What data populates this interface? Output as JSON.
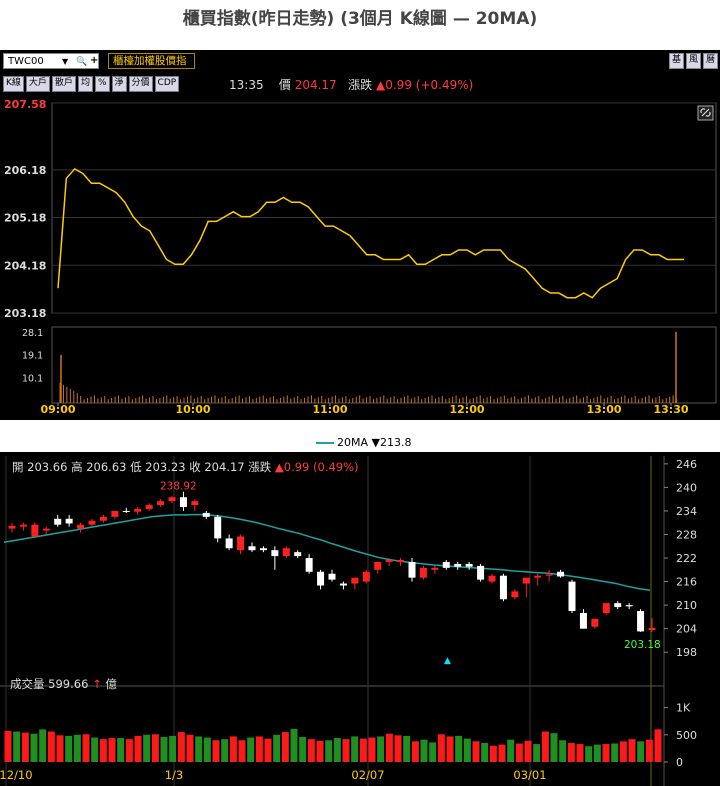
{
  "page_title": "櫃買指數(昨日走勢) (3個月 K線圖  — 20MA)",
  "toolbar": {
    "symbol": "TWC00",
    "symbol_dropdown_icon": "▼",
    "search_icon": "🔍",
    "add_icon": "+",
    "name_tab": "櫃檯加權股價指",
    "right_tabs": [
      "基",
      "風",
      "曆"
    ],
    "buttons": [
      "K線",
      "大戶",
      "散戶",
      "均",
      "%",
      "淨",
      "分價",
      "CDP"
    ],
    "time": "13:35",
    "price_label": "價",
    "price": "204.17",
    "change_label": "漲跌",
    "change": "▲0.99 (+0.49%)",
    "link_icon": "link-icon"
  },
  "intraday": {
    "y_ticks": [
      "207.58",
      "206.18",
      "205.18",
      "204.18",
      "203.18"
    ],
    "vol_ticks": [
      "28.1",
      "19.1",
      "10.1"
    ],
    "x_ticks": [
      "09:00",
      "10:00",
      "11:00",
      "12:00",
      "13:00",
      "13:30"
    ]
  },
  "kline": {
    "legend_label": "20MA",
    "legend_value": "▼213.8",
    "ohlc": {
      "open_label": "開",
      "open": "203.66",
      "high_label": "高",
      "high": "206.63",
      "low_label": "低",
      "low": "203.23",
      "close_label": "收",
      "close": "204.17",
      "change_label": "漲跌",
      "change": "▲0.99 (0.49%)"
    },
    "high_annotation": "238.92",
    "low_annotation": "203.18",
    "y_ticks": [
      "246",
      "240",
      "234",
      "228",
      "222",
      "216",
      "210",
      "204",
      "198"
    ],
    "vol_ticks": [
      "1K",
      "500",
      "0"
    ],
    "x_ticks": [
      "12/10",
      "1/3",
      "02/07",
      "03/01"
    ],
    "volume_label": "成交量",
    "volume_value": "599.66",
    "volume_arrow": "↑",
    "volume_unit": "億"
  },
  "chart_data": [
    {
      "type": "line",
      "title": "",
      "x_ticks": [
        "09:00",
        "10:00",
        "11:00",
        "12:00",
        "13:00",
        "13:30"
      ],
      "ylim": [
        203.18,
        207.58
      ],
      "series": [
        {
          "values": [
            203.7,
            206.0,
            206.2,
            206.1,
            205.9,
            205.9,
            205.8,
            205.7,
            205.5,
            205.2,
            205.0,
            204.9,
            204.6,
            204.3,
            204.2,
            204.2,
            204.4,
            204.7,
            205.1,
            205.1,
            205.2,
            205.3,
            205.2,
            205.2,
            205.3,
            205.5,
            205.5,
            205.6,
            205.5,
            205.5,
            205.4,
            205.2,
            205.0,
            205.0,
            204.9,
            204.8,
            204.6,
            204.4,
            204.4,
            204.3,
            204.3,
            204.3,
            204.4,
            204.2,
            204.2,
            204.3,
            204.4,
            204.4,
            204.5,
            204.5,
            204.4,
            204.5,
            204.5,
            204.5,
            204.3,
            204.2,
            204.1,
            203.9,
            203.7,
            203.6,
            203.6,
            203.5,
            203.5,
            203.6,
            203.5,
            203.7,
            203.8,
            203.9,
            204.3,
            204.5,
            204.5,
            204.4,
            204.4,
            204.3,
            204.3,
            204.3
          ]
        }
      ],
      "volume": [
        28.1
      ]
    },
    {
      "type": "bar",
      "title": "",
      "x_ticks": [
        "12/10",
        "1/3",
        "02/07",
        "03/01"
      ],
      "ylim": [
        198,
        246
      ],
      "candles": [
        {
          "o": 229.5,
          "h": 231,
          "l": 228.5,
          "c": 230.2
        },
        {
          "o": 230.0,
          "h": 231,
          "l": 229,
          "c": 230.5
        },
        {
          "o": 227.5,
          "h": 231,
          "l": 227,
          "c": 230.5
        },
        {
          "o": 229.0,
          "h": 230,
          "l": 228,
          "c": 229.5
        },
        {
          "o": 232.0,
          "h": 233,
          "l": 230,
          "c": 230.5
        },
        {
          "o": 232.0,
          "h": 233,
          "l": 230,
          "c": 230.8
        },
        {
          "o": 229.5,
          "h": 231,
          "l": 228.5,
          "c": 230.5
        },
        {
          "o": 230.5,
          "h": 232,
          "l": 230,
          "c": 231.5
        },
        {
          "o": 231.5,
          "h": 233,
          "l": 231,
          "c": 232.5
        },
        {
          "o": 232.5,
          "h": 234,
          "l": 232,
          "c": 234.0
        },
        {
          "o": 234.0,
          "h": 234.8,
          "l": 233.5,
          "c": 233.8
        },
        {
          "o": 233.8,
          "h": 235,
          "l": 233,
          "c": 234.5
        },
        {
          "o": 234.5,
          "h": 236,
          "l": 234,
          "c": 235.5
        },
        {
          "o": 235.5,
          "h": 237,
          "l": 235,
          "c": 236.5
        },
        {
          "o": 236.5,
          "h": 237.8,
          "l": 236,
          "c": 237.5
        },
        {
          "o": 237.5,
          "h": 238.9,
          "l": 234,
          "c": 235.0
        },
        {
          "o": 235.5,
          "h": 237,
          "l": 234,
          "c": 236.5
        },
        {
          "o": 233.5,
          "h": 234,
          "l": 232,
          "c": 232.5
        },
        {
          "o": 232.5,
          "h": 233,
          "l": 226,
          "c": 227.0
        },
        {
          "o": 227.0,
          "h": 228,
          "l": 224,
          "c": 224.5
        },
        {
          "o": 224.0,
          "h": 228,
          "l": 223,
          "c": 227.5
        },
        {
          "o": 225.0,
          "h": 226,
          "l": 223.5,
          "c": 224.0
        },
        {
          "o": 224.5,
          "h": 225,
          "l": 223.5,
          "c": 224.0
        },
        {
          "o": 224.0,
          "h": 225,
          "l": 219,
          "c": 222.5
        },
        {
          "o": 222.5,
          "h": 225,
          "l": 222,
          "c": 224.5
        },
        {
          "o": 223.5,
          "h": 224,
          "l": 222,
          "c": 222.5
        },
        {
          "o": 222.0,
          "h": 223,
          "l": 218,
          "c": 218.5
        },
        {
          "o": 218.5,
          "h": 219,
          "l": 214,
          "c": 215.0
        },
        {
          "o": 218.0,
          "h": 219,
          "l": 216,
          "c": 216.5
        },
        {
          "o": 215.5,
          "h": 216,
          "l": 214,
          "c": 215.0
        },
        {
          "o": 215.5,
          "h": 217,
          "l": 214,
          "c": 217.0
        },
        {
          "o": 216.0,
          "h": 219,
          "l": 215.5,
          "c": 218.5
        },
        {
          "o": 219.0,
          "h": 221,
          "l": 218,
          "c": 221.0
        },
        {
          "o": 221.0,
          "h": 222,
          "l": 220,
          "c": 221.5
        },
        {
          "o": 221.0,
          "h": 222,
          "l": 220,
          "c": 221.5
        },
        {
          "o": 221.0,
          "h": 222,
          "l": 216,
          "c": 217.0
        },
        {
          "o": 217.0,
          "h": 220,
          "l": 216.5,
          "c": 219.5
        },
        {
          "o": 219.0,
          "h": 220,
          "l": 218,
          "c": 219.5
        },
        {
          "o": 221.0,
          "h": 221.5,
          "l": 219,
          "c": 219.5
        },
        {
          "o": 220.5,
          "h": 221,
          "l": 219,
          "c": 219.8
        },
        {
          "o": 220.5,
          "h": 221,
          "l": 219,
          "c": 219.8
        },
        {
          "o": 220.0,
          "h": 220.5,
          "l": 216,
          "c": 216.5
        },
        {
          "o": 216.0,
          "h": 218,
          "l": 215.5,
          "c": 217.5
        },
        {
          "o": 217.5,
          "h": 218,
          "l": 211,
          "c": 211.5
        },
        {
          "o": 212.0,
          "h": 214,
          "l": 211.5,
          "c": 213.5
        },
        {
          "o": 215.5,
          "h": 217,
          "l": 212,
          "c": 217.0
        },
        {
          "o": 217.0,
          "h": 218,
          "l": 215,
          "c": 217.5
        },
        {
          "o": 217.5,
          "h": 219,
          "l": 216,
          "c": 217.8
        },
        {
          "o": 218.5,
          "h": 219,
          "l": 217,
          "c": 217.3
        },
        {
          "o": 216.0,
          "h": 216.5,
          "l": 208,
          "c": 208.5
        },
        {
          "o": 208.0,
          "h": 209,
          "l": 204,
          "c": 204.0
        },
        {
          "o": 204.5,
          "h": 206.5,
          "l": 204,
          "c": 206.5
        },
        {
          "o": 208.0,
          "h": 210.5,
          "l": 207.5,
          "c": 210.5
        },
        {
          "o": 210.5,
          "h": 211,
          "l": 209,
          "c": 209.5
        },
        {
          "o": 210.0,
          "h": 210.5,
          "l": 209,
          "c": 209.7
        },
        {
          "o": 208.5,
          "h": 209,
          "l": 203.2,
          "c": 203.3
        },
        {
          "o": 203.66,
          "h": 206.63,
          "l": 203.23,
          "c": 204.17
        }
      ],
      "ma20": [
        226,
        226.5,
        227,
        227.5,
        228,
        228.5,
        229,
        229.5,
        230,
        230.5,
        231,
        231.5,
        232,
        232.5,
        232.8,
        233,
        233,
        233.1,
        233,
        232.7,
        232.3,
        231.8,
        231.2,
        230.5,
        229.7,
        229,
        228.3,
        227.4,
        226.6,
        225.6,
        224.7,
        223.8,
        223,
        222.2,
        221.6,
        221.2,
        220.8,
        220.5,
        220.2,
        220,
        219.8,
        219.6,
        219.4,
        219.2,
        219,
        218.7,
        218.5,
        218.3,
        218.1,
        217.8,
        217.4,
        217,
        216.5,
        216,
        215.5,
        214.8,
        214.2,
        213.8
      ],
      "volume": [
        570,
        560,
        540,
        520,
        600,
        560,
        490,
        480,
        500,
        510,
        450,
        420,
        440,
        440,
        420,
        480,
        500,
        510,
        460,
        480,
        550,
        500,
        470,
        450,
        400,
        420,
        470,
        400,
        450,
        470,
        430,
        500,
        550,
        610,
        460,
        420,
        390,
        400,
        440,
        420,
        470,
        430,
        450,
        470,
        520,
        490,
        480,
        380,
        410,
        360,
        510,
        470,
        480,
        430,
        380,
        350,
        300,
        320,
        410,
        340,
        390,
        330,
        560,
        530,
        400,
        350,
        330,
        290,
        320,
        330,
        340,
        380,
        420,
        380,
        410,
        600
      ]
    }
  ]
}
